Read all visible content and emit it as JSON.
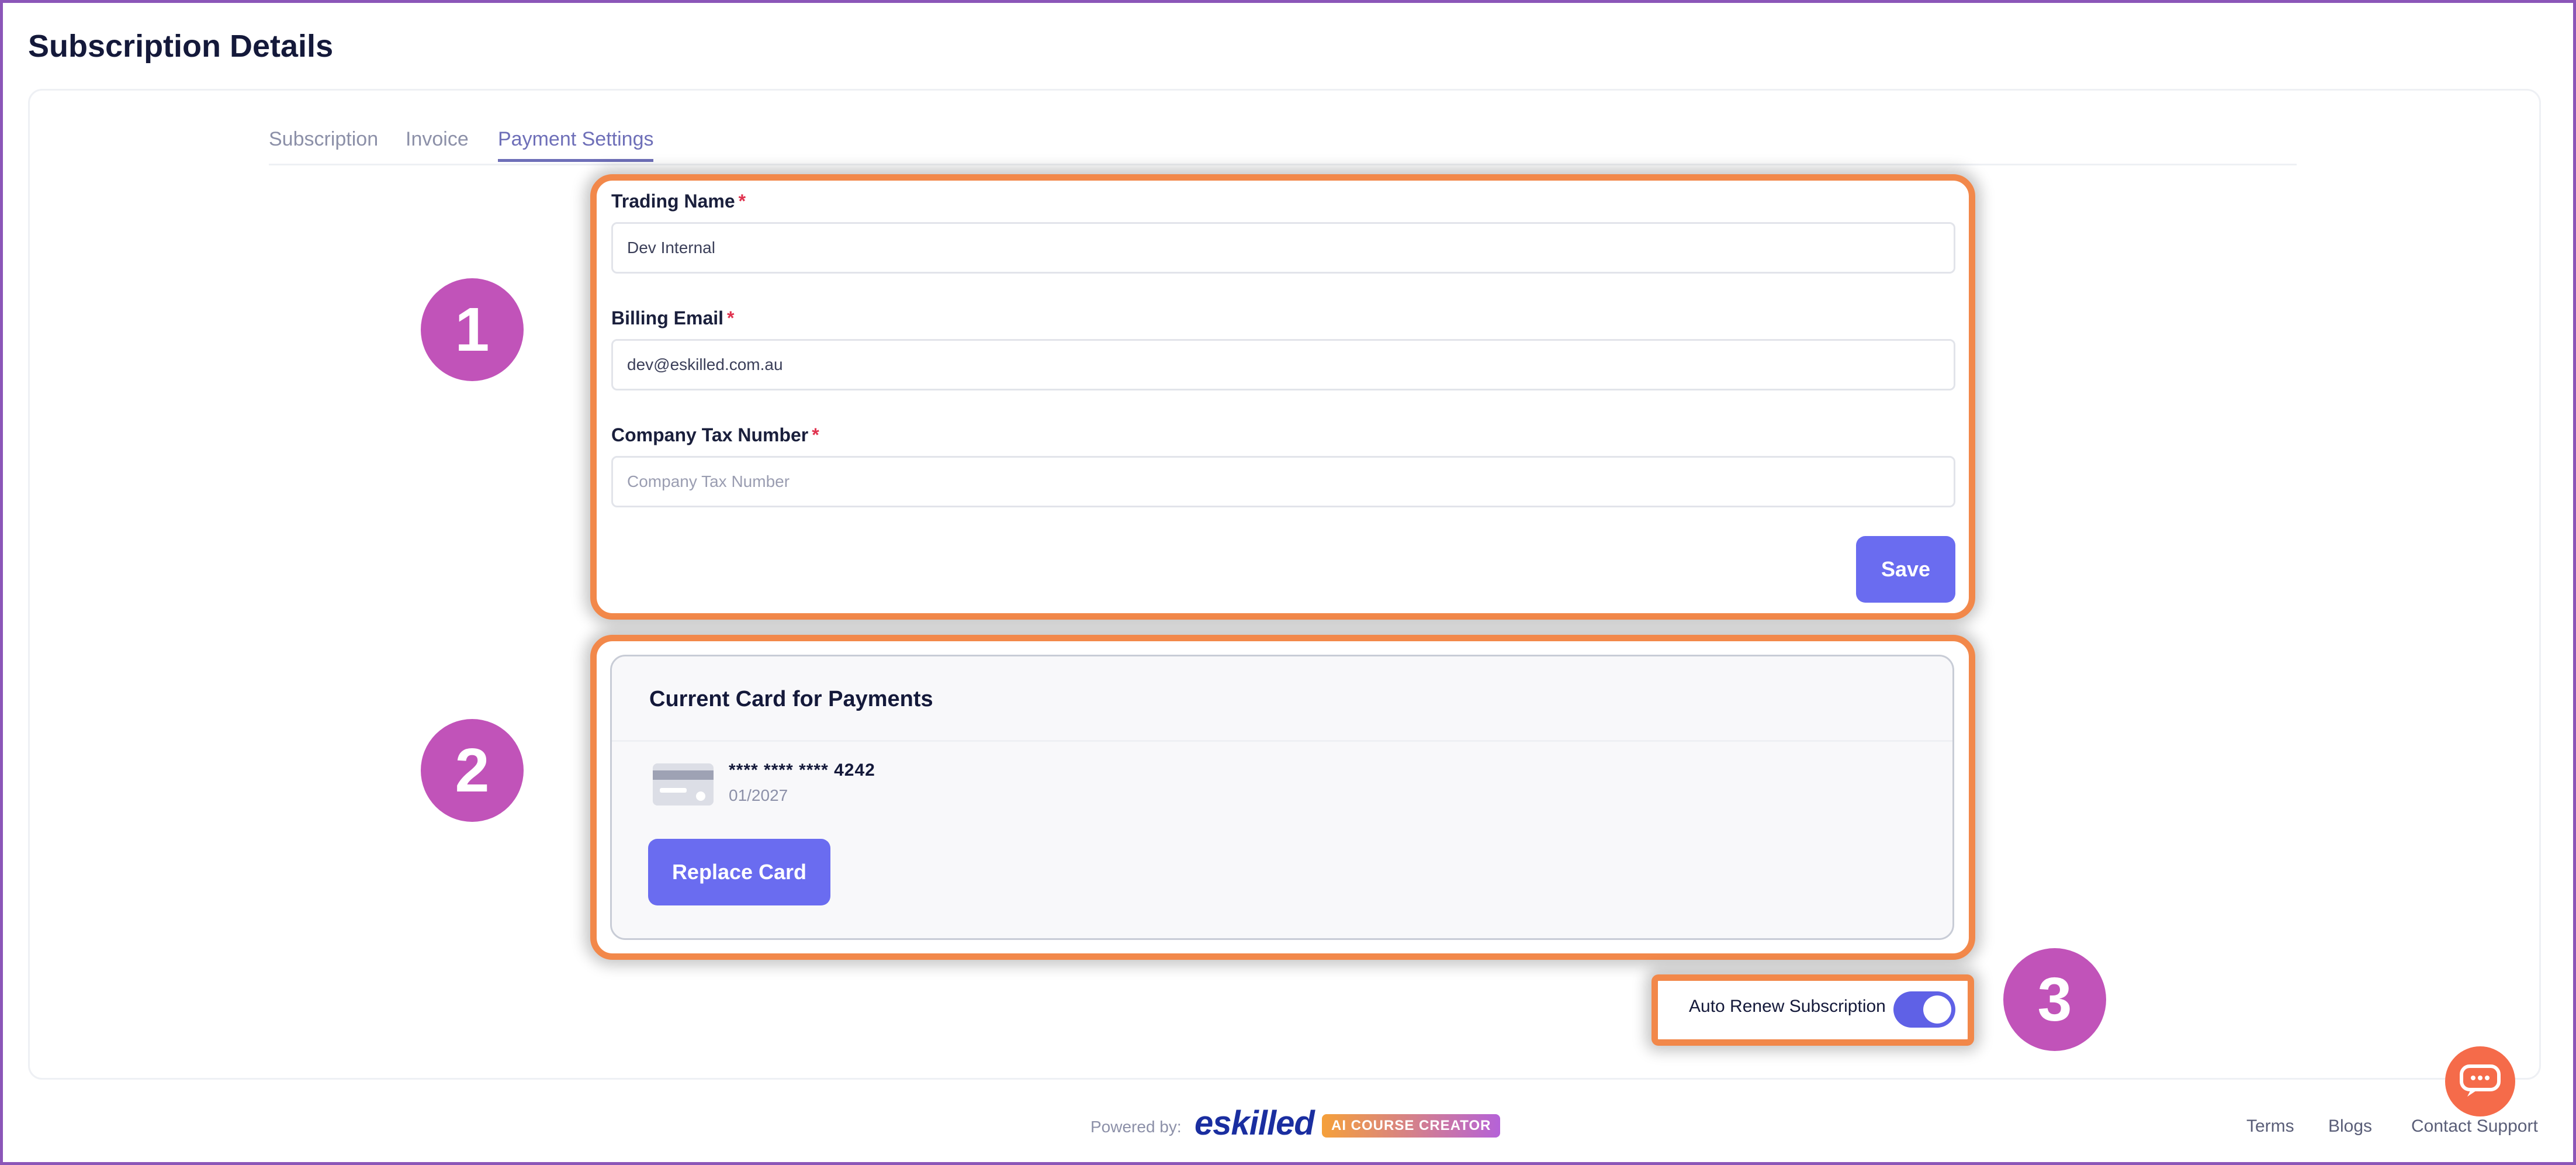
{
  "page": {
    "title": "Subscription Details"
  },
  "tabs": [
    {
      "label": "Subscription",
      "active": false
    },
    {
      "label": "Invoice",
      "active": false
    },
    {
      "label": "Payment Settings",
      "active": true
    }
  ],
  "annotations": {
    "step1": "1",
    "step2": "2",
    "step3": "3",
    "highlight_color": "#f2884a",
    "circle_color": "#c153b9"
  },
  "form": {
    "trading_name": {
      "label": "Trading Name",
      "required": "*",
      "value": "Dev Internal"
    },
    "billing_email": {
      "label": "Billing Email",
      "required": "*",
      "value": "dev@eskilled.com.au"
    },
    "tax_number": {
      "label": "Company Tax Number",
      "required": "*",
      "value": "",
      "placeholder": "Company Tax Number"
    },
    "save_label": "Save"
  },
  "card": {
    "title": "Current Card for Payments",
    "masked_prefix": "**** **** ****",
    "last4": "4242",
    "expiry": "01/2027",
    "replace_label": "Replace Card"
  },
  "auto_renew": {
    "label": "Auto Renew Subscription",
    "enabled": true
  },
  "footer": {
    "powered_by": "Powered by:",
    "logo": "eskilled",
    "badge": "AI COURSE CREATOR",
    "links": [
      "Terms",
      "Blogs",
      "Contact Support"
    ]
  },
  "colors": {
    "accent": "#6a6cf0",
    "chat": "#f56b4a",
    "frame": "#8b56b8"
  }
}
